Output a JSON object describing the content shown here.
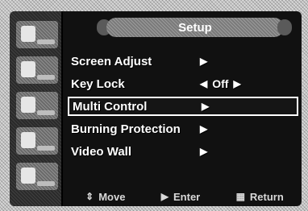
{
  "osd": {
    "title": "Setup",
    "menu": [
      {
        "label": "Screen Adjust",
        "arrow": "▶",
        "selected": false
      },
      {
        "label": "Key Lock",
        "left_arrow": "◀",
        "value": "Off",
        "right_arrow": "▶",
        "selected": false
      },
      {
        "label": "Multi Control",
        "arrow": "▶",
        "selected": true
      },
      {
        "label": "Burning Protection",
        "arrow": "▶",
        "selected": false
      },
      {
        "label": "Video Wall",
        "arrow": "▶",
        "selected": false
      }
    ],
    "footer": {
      "move_icon": "⇕",
      "move_label": "Move",
      "enter_icon": "▶",
      "enter_label": "Enter",
      "return_icon": "▦",
      "return_label": "Return"
    }
  }
}
